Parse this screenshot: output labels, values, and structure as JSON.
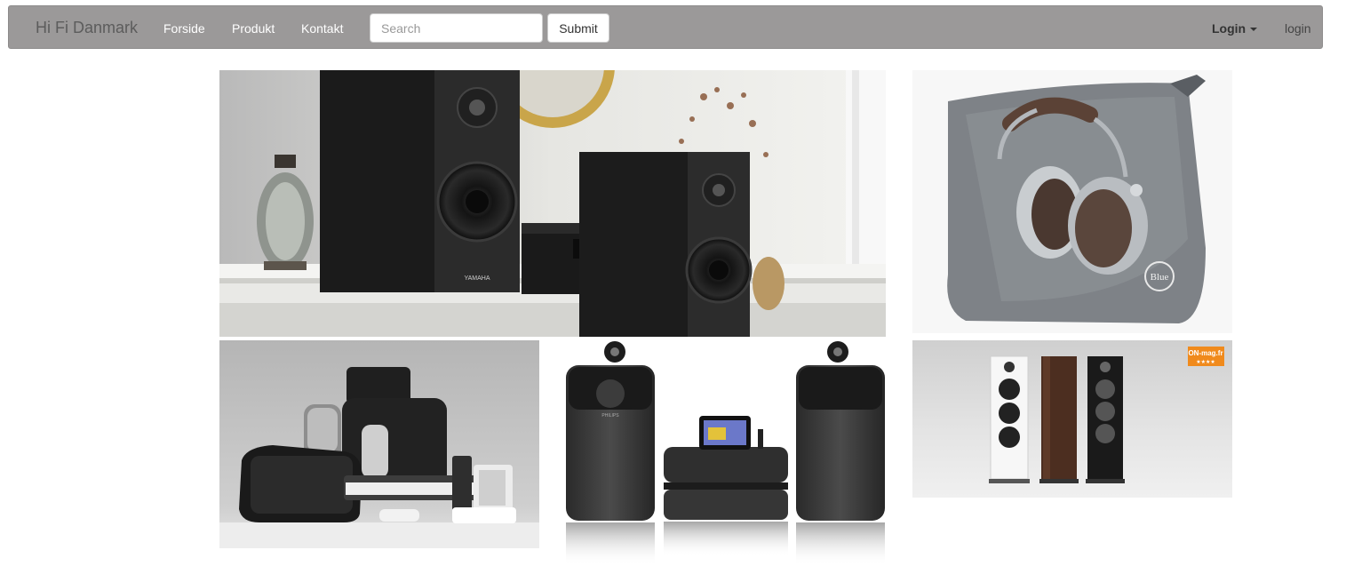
{
  "nav": {
    "brand": "Hi Fi Danmark",
    "links": [
      "Forside",
      "Produkt",
      "Kontakt"
    ],
    "search_placeholder": "Search",
    "submit_label": "Submit",
    "login_dropdown": "Login",
    "login_link": "login"
  },
  "photos": {
    "headphones_logo": "Blue",
    "badge": "ON-mag.fr",
    "badge_stars": "★★★★",
    "brand_yamaha": "YAMAHA",
    "brand_philips": "PHILIPS"
  },
  "colors": {
    "navbar_bg": "#9b9999",
    "nav_text": "#ffffff",
    "brand_text": "#5c5c5c"
  }
}
